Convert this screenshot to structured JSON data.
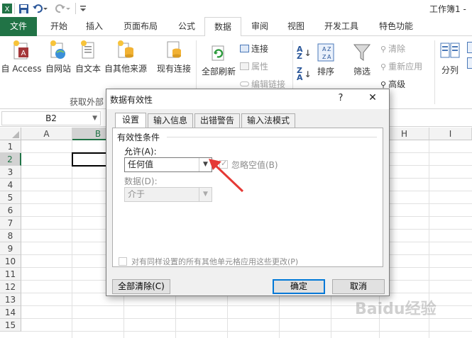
{
  "window": {
    "title": "工作簿1 -"
  },
  "quick_access": {
    "save_icon": "save-icon",
    "undo_icon": "undo-icon",
    "redo_icon": "redo-icon",
    "customize_icon": "customize-icon"
  },
  "tabs": [
    "文件",
    "开始",
    "插入",
    "页面布局",
    "公式",
    "数据",
    "审阅",
    "视图",
    "开发工具",
    "特色功能"
  ],
  "ribbon": {
    "get_external": {
      "access": "自 Access",
      "web": "自网站",
      "text": "自文本",
      "other": "自其他来源",
      "existing": "现有连接",
      "group_label": "获取外部"
    },
    "connections": {
      "refresh_all": "全部刷新",
      "connections": "连接",
      "properties": "属性",
      "edit_links": "编辑链接"
    },
    "sort_filter": {
      "sort_az": "A→Z",
      "sort_za": "Z→A",
      "sort": "排序",
      "filter": "筛选",
      "clear": "清除",
      "reapply": "重新应用",
      "advanced": "高级"
    },
    "tools": {
      "text_to_columns": "分列"
    }
  },
  "name_box": "B2",
  "columns": [
    "A",
    "B",
    "C",
    "D",
    "E",
    "F",
    "G",
    "H",
    "I"
  ],
  "rows": [
    "1",
    "2",
    "3",
    "4",
    "5",
    "6",
    "7",
    "8",
    "9",
    "10",
    "11",
    "12",
    "13",
    "14",
    "15"
  ],
  "dialog": {
    "title": "数据有效性",
    "help": "?",
    "close": "✕",
    "tabs": [
      "设置",
      "输入信息",
      "出错警告",
      "输入法模式"
    ],
    "section_label": "有效性条件",
    "allow_label": "允许(A):",
    "allow_value": "任何值",
    "ignore_blank_label": "忽略空值(B)",
    "data_label": "数据(D):",
    "data_value": "介于",
    "apply_all_label": "对有同样设置的所有其他单元格应用这些更改(P)",
    "clear_all_button": "全部清除(C)",
    "ok_button": "确定",
    "cancel_button": "取消"
  },
  "watermark": "Baidu经验",
  "colors": {
    "excel_green": "#217346",
    "arrow_red": "#e53935",
    "selection_green": "#217346"
  }
}
